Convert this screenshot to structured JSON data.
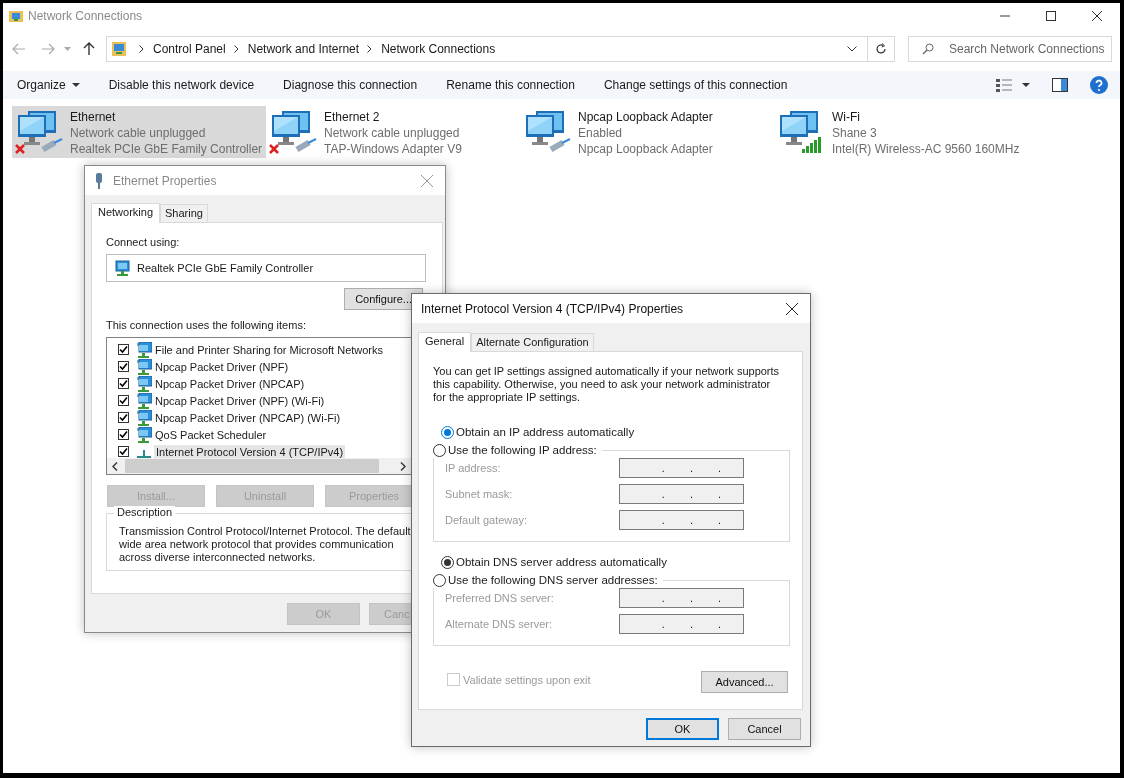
{
  "window": {
    "title": "Network Connections"
  },
  "address_bar": {
    "path": [
      "Control Panel",
      "Network and Internet",
      "Network Connections"
    ]
  },
  "search": {
    "placeholder": "Search Network Connections"
  },
  "command_bar": [
    {
      "label": "Organize",
      "dropdown": true
    },
    {
      "label": "Disable this network device",
      "dropdown": false
    },
    {
      "label": "Diagnose this connection",
      "dropdown": false
    },
    {
      "label": "Rename this connection",
      "dropdown": false
    },
    {
      "label": "Change settings of this connection",
      "dropdown": false
    }
  ],
  "adapters": [
    {
      "name": "Ethernet",
      "status": "Network cable unplugged",
      "device": "Realtek PCIe GbE Family Controller",
      "selected": true,
      "kind": "unplugged"
    },
    {
      "name": "Ethernet 2",
      "status": "Network cable unplugged",
      "device": "TAP-Windows Adapter V9",
      "selected": false,
      "kind": "unplugged"
    },
    {
      "name": "Npcap Loopback Adapter",
      "status": "Enabled",
      "device": "Npcap Loopback Adapter",
      "selected": false,
      "kind": "wired"
    },
    {
      "name": "Wi-Fi",
      "status": "Shane 3",
      "device": "Intel(R) Wireless-AC 9560 160MHz",
      "selected": false,
      "kind": "wireless"
    }
  ],
  "ethernet_properties": {
    "title": "Ethernet Properties",
    "tabs": [
      {
        "label": "Networking",
        "selected": true
      },
      {
        "label": "Sharing",
        "selected": false
      }
    ],
    "connect_using_label": "Connect using:",
    "adapter": "Realtek PCIe GbE Family Controller",
    "configure_button": "Configure...",
    "items_label": "This connection uses the following items:",
    "items": [
      {
        "label": "File and Printer Sharing for Microsoft Networks",
        "checked": true,
        "selected": false,
        "kind": "service"
      },
      {
        "label": "Npcap Packet Driver (NPF)",
        "checked": true,
        "selected": false,
        "kind": "service"
      },
      {
        "label": "Npcap Packet Driver (NPCAP)",
        "checked": true,
        "selected": false,
        "kind": "service"
      },
      {
        "label": "Npcap Packet Driver (NPF) (Wi-Fi)",
        "checked": true,
        "selected": false,
        "kind": "service"
      },
      {
        "label": "Npcap Packet Driver (NPCAP) (Wi-Fi)",
        "checked": true,
        "selected": false,
        "kind": "service"
      },
      {
        "label": "QoS Packet Scheduler",
        "checked": true,
        "selected": false,
        "kind": "service"
      },
      {
        "label": "Internet Protocol Version 4 (TCP/IPv4)",
        "checked": true,
        "selected": true,
        "kind": "protocol"
      }
    ],
    "buttons": [
      {
        "label": "Install...",
        "disabled": true
      },
      {
        "label": "Uninstall",
        "disabled": true
      },
      {
        "label": "Properties",
        "disabled": true
      }
    ],
    "description": {
      "title": "Description",
      "text": "Transmission Control Protocol/Internet Protocol. The default wide area network protocol that provides communication across diverse interconnected networks."
    },
    "footer_buttons": [
      {
        "label": "OK",
        "disabled": true
      },
      {
        "label": "Canc",
        "disabled": true
      }
    ]
  },
  "ipv4_properties": {
    "title": "Internet Protocol Version 4 (TCP/IPv4) Properties",
    "tabs": [
      {
        "label": "General",
        "selected": true
      },
      {
        "label": "Alternate Configuration",
        "selected": false
      }
    ],
    "intro": "You can get IP settings assigned automatically if your network supports this capability. Otherwise, you need to ask your network administrator for the appropriate IP settings.",
    "sections": [
      {
        "auto": {
          "label": "Obtain an IP address automatically",
          "selected": true,
          "focused": true
        },
        "manual": {
          "label": "Use the following IP address:",
          "selected": false,
          "focused": false
        },
        "fields": [
          {
            "label": "IP address:",
            "value": ". . .",
            "disabled": true
          },
          {
            "label": "Subnet mask:",
            "value": ". . .",
            "disabled": true
          },
          {
            "label": "Default gateway:",
            "value": ". . .",
            "disabled": true
          }
        ]
      },
      {
        "auto": {
          "label": "Obtain DNS server address automatically",
          "selected": true,
          "focused": false
        },
        "manual": {
          "label": "Use the following DNS server addresses:",
          "selected": false,
          "focused": false
        },
        "fields": [
          {
            "label": "Preferred DNS server:",
            "value": ". . .",
            "disabled": true
          },
          {
            "label": "Alternate DNS server:",
            "value": ". . .",
            "disabled": true
          }
        ]
      }
    ],
    "validate": {
      "label": "Validate settings upon exit",
      "checked": false,
      "disabled": true
    },
    "advanced_button": "Advanced...",
    "footer_buttons": [
      {
        "label": "OK",
        "default": true
      },
      {
        "label": "Cancel",
        "default": false
      }
    ]
  }
}
